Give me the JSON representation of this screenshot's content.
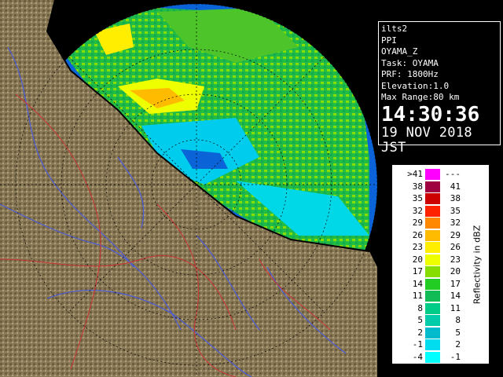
{
  "info": {
    "station": "ilts2",
    "scan_type": "PPI",
    "product": "OYAMA_Z",
    "task": "Task: OYAMA",
    "prf": "PRF: 1800Hz",
    "elevation": "Elevation:1.0",
    "max_range": "Max Range:80 km",
    "time": "14:30:36",
    "date": "19 NOV 2018 JST"
  },
  "legend": {
    "title": "Reflectivity in dBZ",
    "rows": [
      {
        "low": ">41",
        "high": "---",
        "color": "#ff00ff"
      },
      {
        "low": "38",
        "high": "41",
        "color": "#a00040"
      },
      {
        "low": "35",
        "high": "38",
        "color": "#cc0000"
      },
      {
        "low": "32",
        "high": "35",
        "color": "#ff2200"
      },
      {
        "low": "29",
        "high": "32",
        "color": "#ff8800"
      },
      {
        "low": "26",
        "high": "29",
        "color": "#ffbb00"
      },
      {
        "low": "23",
        "high": "26",
        "color": "#ffee00"
      },
      {
        "low": "20",
        "high": "23",
        "color": "#eeff00"
      },
      {
        "low": "17",
        "high": "20",
        "color": "#88dd00"
      },
      {
        "low": "14",
        "high": "17",
        "color": "#22cc22"
      },
      {
        "low": "11",
        "high": "14",
        "color": "#11bb55"
      },
      {
        "low": "8",
        "high": "11",
        "color": "#00cc88"
      },
      {
        "low": "5",
        "high": "8",
        "color": "#00ccaa"
      },
      {
        "low": "2",
        "high": "5",
        "color": "#00bbcc"
      },
      {
        "low": "-1",
        "high": "2",
        "color": "#00ddee"
      },
      {
        "low": "-4",
        "high": "-1",
        "color": "#00ffff"
      }
    ]
  },
  "colors": {
    "sea_no_echo": "#0a64d8",
    "terrain": "#8a7a58",
    "rivers": "#4a5ad8",
    "boundaries": "#cc3333",
    "coastline": "#000000"
  }
}
